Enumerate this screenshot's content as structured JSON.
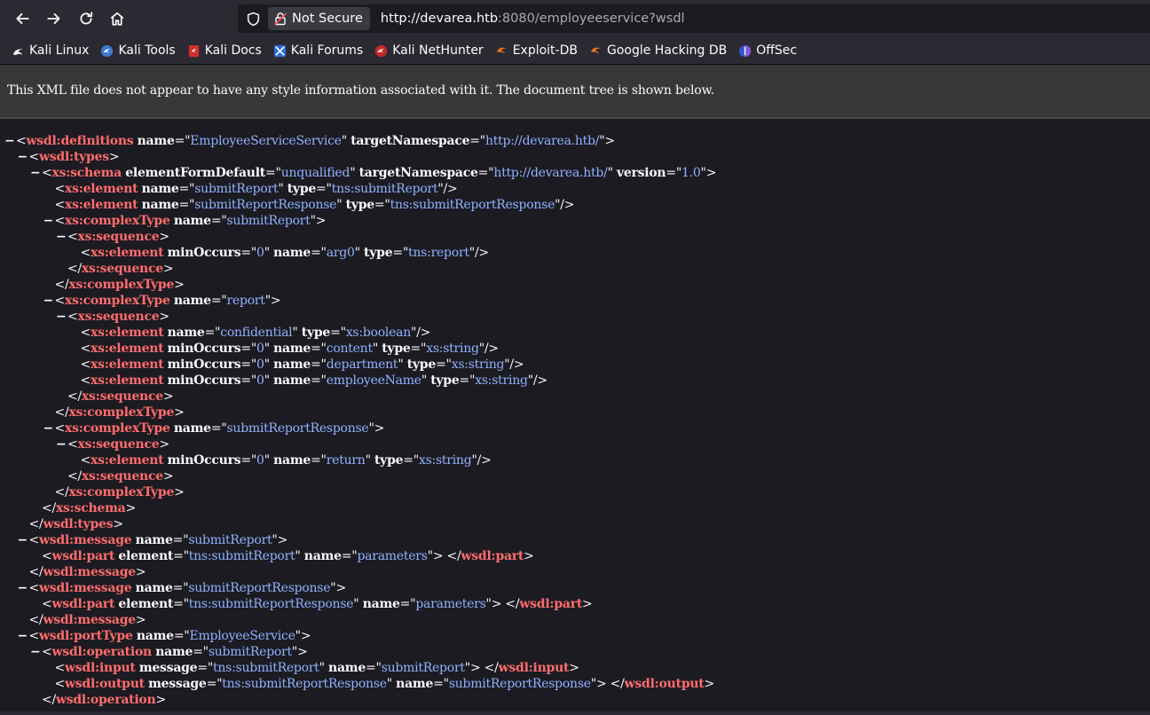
{
  "browser": {
    "not_secure_label": "Not Secure",
    "url_host": "http://devarea.htb",
    "url_rest": ":8080/employeeservice?wsdl",
    "bookmarks": [
      {
        "label": "Kali Linux",
        "icon": "kali-dragon-icon"
      },
      {
        "label": "Kali Tools",
        "icon": "kali-tools-icon"
      },
      {
        "label": "Kali Docs",
        "icon": "kali-docs-icon"
      },
      {
        "label": "Kali Forums",
        "icon": "kali-forums-icon"
      },
      {
        "label": "Kali NetHunter",
        "icon": "nethunter-icon"
      },
      {
        "label": "Exploit-DB",
        "icon": "exploit-db-icon"
      },
      {
        "label": "Google Hacking DB",
        "icon": "ghdb-icon"
      },
      {
        "label": "OffSec",
        "icon": "offsec-icon"
      }
    ]
  },
  "xml_notice": "This XML file does not appear to have any style information associated with it. The document tree is shown below.",
  "xml_lines": [
    {
      "fold": true,
      "parts": [
        [
          "p",
          "<"
        ],
        [
          "t",
          "wsdl:definitions"
        ],
        [
          "s",
          " "
        ],
        [
          "a",
          "name"
        ],
        [
          "p",
          "=\""
        ],
        [
          "v",
          "EmployeeServiceService"
        ],
        [
          "p",
          "\" "
        ],
        [
          "a",
          "targetNamespace"
        ],
        [
          "p",
          "=\""
        ],
        [
          "v",
          "http://devarea.htb/"
        ],
        [
          "p",
          "\">"
        ]
      ]
    },
    {
      "fold": true,
      "parts": [
        [
          "p",
          "<"
        ],
        [
          "t",
          "wsdl:types"
        ],
        [
          "p",
          ">"
        ]
      ]
    },
    {
      "fold": true,
      "parts": [
        [
          "p",
          "<"
        ],
        [
          "t",
          "xs:schema"
        ],
        [
          "s",
          " "
        ],
        [
          "a",
          "elementFormDefault"
        ],
        [
          "p",
          "=\""
        ],
        [
          "v",
          "unqualified"
        ],
        [
          "p",
          "\" "
        ],
        [
          "a",
          "targetNamespace"
        ],
        [
          "p",
          "=\""
        ],
        [
          "v",
          "http://devarea.htb/"
        ],
        [
          "p",
          "\" "
        ],
        [
          "a",
          "version"
        ],
        [
          "p",
          "=\""
        ],
        [
          "v",
          "1.0"
        ],
        [
          "p",
          "\">"
        ]
      ]
    },
    {
      "fold": false,
      "parts": [
        [
          "p",
          "<"
        ],
        [
          "t",
          "xs:element"
        ],
        [
          "s",
          " "
        ],
        [
          "a",
          "name"
        ],
        [
          "p",
          "=\""
        ],
        [
          "v",
          "submitReport"
        ],
        [
          "p",
          "\" "
        ],
        [
          "a",
          "type"
        ],
        [
          "p",
          "=\""
        ],
        [
          "v",
          "tns:submitReport"
        ],
        [
          "p",
          "\"/>"
        ]
      ]
    },
    {
      "fold": false,
      "parts": [
        [
          "p",
          "<"
        ],
        [
          "t",
          "xs:element"
        ],
        [
          "s",
          " "
        ],
        [
          "a",
          "name"
        ],
        [
          "p",
          "=\""
        ],
        [
          "v",
          "submitReportResponse"
        ],
        [
          "p",
          "\" "
        ],
        [
          "a",
          "type"
        ],
        [
          "p",
          "=\""
        ],
        [
          "v",
          "tns:submitReportResponse"
        ],
        [
          "p",
          "\"/>"
        ]
      ]
    },
    {
      "fold": true,
      "parts": [
        [
          "p",
          "<"
        ],
        [
          "t",
          "xs:complexType"
        ],
        [
          "s",
          " "
        ],
        [
          "a",
          "name"
        ],
        [
          "p",
          "=\""
        ],
        [
          "v",
          "submitReport"
        ],
        [
          "p",
          "\">"
        ]
      ]
    },
    {
      "fold": true,
      "parts": [
        [
          "p",
          "<"
        ],
        [
          "t",
          "xs:sequence"
        ],
        [
          "p",
          ">"
        ]
      ]
    },
    {
      "fold": false,
      "parts": [
        [
          "p",
          "<"
        ],
        [
          "t",
          "xs:element"
        ],
        [
          "s",
          " "
        ],
        [
          "a",
          "minOccurs"
        ],
        [
          "p",
          "=\""
        ],
        [
          "v",
          "0"
        ],
        [
          "p",
          "\" "
        ],
        [
          "a",
          "name"
        ],
        [
          "p",
          "=\""
        ],
        [
          "v",
          "arg0"
        ],
        [
          "p",
          "\" "
        ],
        [
          "a",
          "type"
        ],
        [
          "p",
          "=\""
        ],
        [
          "v",
          "tns:report"
        ],
        [
          "p",
          "\"/>"
        ]
      ]
    },
    {
      "fold": false,
      "parts": [
        [
          "p",
          "</"
        ],
        [
          "t",
          "xs:sequence"
        ],
        [
          "p",
          ">"
        ]
      ]
    },
    {
      "fold": false,
      "parts": [
        [
          "p",
          "</"
        ],
        [
          "t",
          "xs:complexType"
        ],
        [
          "p",
          ">"
        ]
      ]
    },
    {
      "fold": true,
      "parts": [
        [
          "p",
          "<"
        ],
        [
          "t",
          "xs:complexType"
        ],
        [
          "s",
          " "
        ],
        [
          "a",
          "name"
        ],
        [
          "p",
          "=\""
        ],
        [
          "v",
          "report"
        ],
        [
          "p",
          "\">"
        ]
      ]
    },
    {
      "fold": true,
      "parts": [
        [
          "p",
          "<"
        ],
        [
          "t",
          "xs:sequence"
        ],
        [
          "p",
          ">"
        ]
      ]
    },
    {
      "fold": false,
      "parts": [
        [
          "p",
          "<"
        ],
        [
          "t",
          "xs:element"
        ],
        [
          "s",
          " "
        ],
        [
          "a",
          "name"
        ],
        [
          "p",
          "=\""
        ],
        [
          "v",
          "confidential"
        ],
        [
          "p",
          "\" "
        ],
        [
          "a",
          "type"
        ],
        [
          "p",
          "=\""
        ],
        [
          "v",
          "xs:boolean"
        ],
        [
          "p",
          "\"/>"
        ]
      ]
    },
    {
      "fold": false,
      "parts": [
        [
          "p",
          "<"
        ],
        [
          "t",
          "xs:element"
        ],
        [
          "s",
          " "
        ],
        [
          "a",
          "minOccurs"
        ],
        [
          "p",
          "=\""
        ],
        [
          "v",
          "0"
        ],
        [
          "p",
          "\" "
        ],
        [
          "a",
          "name"
        ],
        [
          "p",
          "=\""
        ],
        [
          "v",
          "content"
        ],
        [
          "p",
          "\" "
        ],
        [
          "a",
          "type"
        ],
        [
          "p",
          "=\""
        ],
        [
          "v",
          "xs:string"
        ],
        [
          "p",
          "\"/>"
        ]
      ]
    },
    {
      "fold": false,
      "parts": [
        [
          "p",
          "<"
        ],
        [
          "t",
          "xs:element"
        ],
        [
          "s",
          " "
        ],
        [
          "a",
          "minOccurs"
        ],
        [
          "p",
          "=\""
        ],
        [
          "v",
          "0"
        ],
        [
          "p",
          "\" "
        ],
        [
          "a",
          "name"
        ],
        [
          "p",
          "=\""
        ],
        [
          "v",
          "department"
        ],
        [
          "p",
          "\" "
        ],
        [
          "a",
          "type"
        ],
        [
          "p",
          "=\""
        ],
        [
          "v",
          "xs:string"
        ],
        [
          "p",
          "\"/>"
        ]
      ]
    },
    {
      "fold": false,
      "parts": [
        [
          "p",
          "<"
        ],
        [
          "t",
          "xs:element"
        ],
        [
          "s",
          " "
        ],
        [
          "a",
          "minOccurs"
        ],
        [
          "p",
          "=\""
        ],
        [
          "v",
          "0"
        ],
        [
          "p",
          "\" "
        ],
        [
          "a",
          "name"
        ],
        [
          "p",
          "=\""
        ],
        [
          "v",
          "employeeName"
        ],
        [
          "p",
          "\" "
        ],
        [
          "a",
          "type"
        ],
        [
          "p",
          "=\""
        ],
        [
          "v",
          "xs:string"
        ],
        [
          "p",
          "\"/>"
        ]
      ]
    },
    {
      "fold": false,
      "parts": [
        [
          "p",
          "</"
        ],
        [
          "t",
          "xs:sequence"
        ],
        [
          "p",
          ">"
        ]
      ]
    },
    {
      "fold": false,
      "parts": [
        [
          "p",
          "</"
        ],
        [
          "t",
          "xs:complexType"
        ],
        [
          "p",
          ">"
        ]
      ]
    },
    {
      "fold": true,
      "parts": [
        [
          "p",
          "<"
        ],
        [
          "t",
          "xs:complexType"
        ],
        [
          "s",
          " "
        ],
        [
          "a",
          "name"
        ],
        [
          "p",
          "=\""
        ],
        [
          "v",
          "submitReportResponse"
        ],
        [
          "p",
          "\">"
        ]
      ]
    },
    {
      "fold": true,
      "parts": [
        [
          "p",
          "<"
        ],
        [
          "t",
          "xs:sequence"
        ],
        [
          "p",
          ">"
        ]
      ]
    },
    {
      "fold": false,
      "parts": [
        [
          "p",
          "<"
        ],
        [
          "t",
          "xs:element"
        ],
        [
          "s",
          " "
        ],
        [
          "a",
          "minOccurs"
        ],
        [
          "p",
          "=\""
        ],
        [
          "v",
          "0"
        ],
        [
          "p",
          "\" "
        ],
        [
          "a",
          "name"
        ],
        [
          "p",
          "=\""
        ],
        [
          "v",
          "return"
        ],
        [
          "p",
          "\" "
        ],
        [
          "a",
          "type"
        ],
        [
          "p",
          "=\""
        ],
        [
          "v",
          "xs:string"
        ],
        [
          "p",
          "\"/>"
        ]
      ]
    },
    {
      "fold": false,
      "parts": [
        [
          "p",
          "</"
        ],
        [
          "t",
          "xs:sequence"
        ],
        [
          "p",
          ">"
        ]
      ]
    },
    {
      "fold": false,
      "parts": [
        [
          "p",
          "</"
        ],
        [
          "t",
          "xs:complexType"
        ],
        [
          "p",
          ">"
        ]
      ]
    },
    {
      "fold": false,
      "parts": [
        [
          "p",
          "</"
        ],
        [
          "t",
          "xs:schema"
        ],
        [
          "p",
          ">"
        ]
      ]
    },
    {
      "fold": false,
      "parts": [
        [
          "p",
          "</"
        ],
        [
          "t",
          "wsdl:types"
        ],
        [
          "p",
          ">"
        ]
      ]
    },
    {
      "fold": true,
      "parts": [
        [
          "p",
          "<"
        ],
        [
          "t",
          "wsdl:message"
        ],
        [
          "s",
          " "
        ],
        [
          "a",
          "name"
        ],
        [
          "p",
          "=\""
        ],
        [
          "v",
          "submitReport"
        ],
        [
          "p",
          "\">"
        ]
      ]
    },
    {
      "fold": false,
      "parts": [
        [
          "p",
          "<"
        ],
        [
          "t",
          "wsdl:part"
        ],
        [
          "s",
          " "
        ],
        [
          "a",
          "element"
        ],
        [
          "p",
          "=\""
        ],
        [
          "v",
          "tns:submitReport"
        ],
        [
          "p",
          "\" "
        ],
        [
          "a",
          "name"
        ],
        [
          "p",
          "=\""
        ],
        [
          "v",
          "parameters"
        ],
        [
          "p",
          "\"> </"
        ],
        [
          "t",
          "wsdl:part"
        ],
        [
          "p",
          ">"
        ]
      ]
    },
    {
      "fold": false,
      "parts": [
        [
          "p",
          "</"
        ],
        [
          "t",
          "wsdl:message"
        ],
        [
          "p",
          ">"
        ]
      ]
    },
    {
      "fold": true,
      "parts": [
        [
          "p",
          "<"
        ],
        [
          "t",
          "wsdl:message"
        ],
        [
          "s",
          " "
        ],
        [
          "a",
          "name"
        ],
        [
          "p",
          "=\""
        ],
        [
          "v",
          "submitReportResponse"
        ],
        [
          "p",
          "\">"
        ]
      ]
    },
    {
      "fold": false,
      "parts": [
        [
          "p",
          "<"
        ],
        [
          "t",
          "wsdl:part"
        ],
        [
          "s",
          " "
        ],
        [
          "a",
          "element"
        ],
        [
          "p",
          "=\""
        ],
        [
          "v",
          "tns:submitReportResponse"
        ],
        [
          "p",
          "\" "
        ],
        [
          "a",
          "name"
        ],
        [
          "p",
          "=\""
        ],
        [
          "v",
          "parameters"
        ],
        [
          "p",
          "\"> </"
        ],
        [
          "t",
          "wsdl:part"
        ],
        [
          "p",
          ">"
        ]
      ]
    },
    {
      "fold": false,
      "parts": [
        [
          "p",
          "</"
        ],
        [
          "t",
          "wsdl:message"
        ],
        [
          "p",
          ">"
        ]
      ]
    },
    {
      "fold": true,
      "parts": [
        [
          "p",
          "<"
        ],
        [
          "t",
          "wsdl:portType"
        ],
        [
          "s",
          " "
        ],
        [
          "a",
          "name"
        ],
        [
          "p",
          "=\""
        ],
        [
          "v",
          "EmployeeService"
        ],
        [
          "p",
          "\">"
        ]
      ]
    },
    {
      "fold": true,
      "parts": [
        [
          "p",
          "<"
        ],
        [
          "t",
          "wsdl:operation"
        ],
        [
          "s",
          " "
        ],
        [
          "a",
          "name"
        ],
        [
          "p",
          "=\""
        ],
        [
          "v",
          "submitReport"
        ],
        [
          "p",
          "\">"
        ]
      ]
    },
    {
      "fold": false,
      "parts": [
        [
          "p",
          "<"
        ],
        [
          "t",
          "wsdl:input"
        ],
        [
          "s",
          " "
        ],
        [
          "a",
          "message"
        ],
        [
          "p",
          "=\""
        ],
        [
          "v",
          "tns:submitReport"
        ],
        [
          "p",
          "\" "
        ],
        [
          "a",
          "name"
        ],
        [
          "p",
          "=\""
        ],
        [
          "v",
          "submitReport"
        ],
        [
          "p",
          "\"> </"
        ],
        [
          "t",
          "wsdl:input"
        ],
        [
          "p",
          ">"
        ]
      ]
    },
    {
      "fold": false,
      "parts": [
        [
          "p",
          "<"
        ],
        [
          "t",
          "wsdl:output"
        ],
        [
          "s",
          " "
        ],
        [
          "a",
          "message"
        ],
        [
          "p",
          "=\""
        ],
        [
          "v",
          "tns:submitReportResponse"
        ],
        [
          "p",
          "\" "
        ],
        [
          "a",
          "name"
        ],
        [
          "p",
          "=\""
        ],
        [
          "v",
          "submitReportResponse"
        ],
        [
          "p",
          "\"> </"
        ],
        [
          "t",
          "wsdl:output"
        ],
        [
          "p",
          ">"
        ]
      ]
    },
    {
      "fold": false,
      "parts": [
        [
          "p",
          "</"
        ],
        [
          "t",
          "wsdl:operation"
        ],
        [
          "p",
          ">"
        ]
      ]
    }
  ]
}
